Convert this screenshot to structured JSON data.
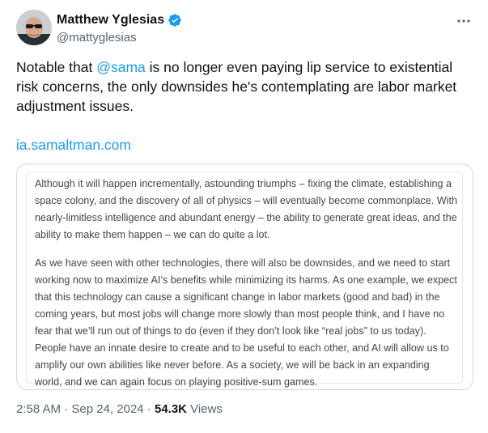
{
  "user": {
    "display_name": "Matthew Yglesias",
    "handle": "@mattyglesias",
    "verified_color": "#1d9bf0"
  },
  "tweet": {
    "text_before": "Notable that ",
    "mention": "@sama",
    "text_after": " is no longer even paying lip service to existential risk concerns, the only downsides he's contemplating are labor market adjustment issues.",
    "link": "ia.samaltman.com"
  },
  "image": {
    "paragraphs": [
      "Although it will happen incrementally, astounding triumphs – fixing the climate, establishing a space colony, and the discovery of all of physics – will eventually become commonplace. With nearly-limitless intelligence and abundant energy – the ability to generate great ideas, and the ability to make them happen – we can do quite a lot.",
      "As we have seen with other technologies, there will also be downsides, and we need to start working now to maximize AI’s benefits while minimizing its harms. As one example, we expect that this technology can cause a significant change in labor markets (good and bad) in the coming years, but most jobs will change more slowly than most people think, and I have no fear that we’ll run out of things to do (even if they don’t look like “real jobs” to us today). People have an innate desire to create and to be useful to each other, and AI will allow us to amplify our own abilities like never before. As a society, we will be back in an expanding world, and we can again focus on playing positive-sum games."
    ]
  },
  "meta": {
    "time": "2:58 AM",
    "separator": " · ",
    "date": "Sep 24, 2024",
    "separator2": " · ",
    "views_count": "54.3K",
    "views_label": " Views"
  },
  "icons": {
    "avatar": "avatar-photo",
    "verified": "verified-badge-icon",
    "more": "more-options-icon"
  }
}
